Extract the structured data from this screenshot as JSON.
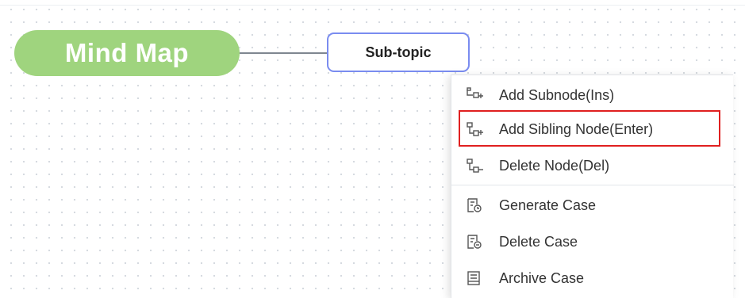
{
  "mind_map": {
    "root_label": "Mind Map",
    "subtopic_label": "Sub-topic"
  },
  "context_menu": {
    "items": [
      {
        "label": "Add Subnode(Ins)",
        "icon": "add-subnode-icon"
      },
      {
        "label": "Add Sibling Node(Enter)",
        "icon": "add-sibling-node-icon"
      },
      {
        "label": "Delete Node(Del)",
        "icon": "delete-node-icon"
      },
      {
        "label": "Generate Case",
        "icon": "generate-case-icon"
      },
      {
        "label": "Delete Case",
        "icon": "delete-case-icon"
      },
      {
        "label": "Archive Case",
        "icon": "archive-case-icon"
      }
    ],
    "highlighted_item": "Add Sibling Node(Enter)"
  },
  "colors": {
    "root_fill": "#9fd47e",
    "subtopic_border": "#7a8cf0",
    "highlight_border": "#e02020",
    "canvas_dots": "#d3d8de"
  }
}
